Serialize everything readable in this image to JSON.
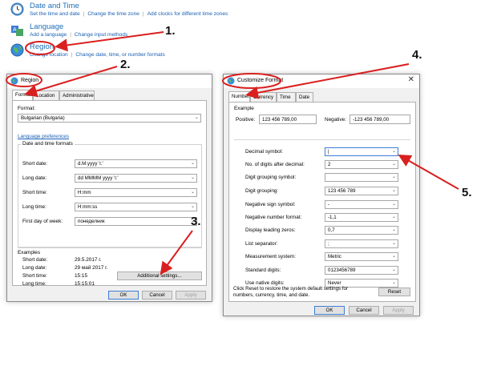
{
  "control_panel": {
    "date_time": {
      "title": "Date and Time",
      "links": [
        "Set the time and date",
        "Change the time zone",
        "Add clocks for different time zones"
      ]
    },
    "language": {
      "title": "Language",
      "links": [
        "Add a language",
        "Change input methods"
      ]
    },
    "region": {
      "title": "Region",
      "links": [
        "Change location",
        "Change date, time, or number formats"
      ]
    }
  },
  "region_dialog": {
    "title": "Region",
    "tabs": [
      "Formats",
      "Location",
      "Administrative"
    ],
    "format_label": "Format:",
    "format_value": "Bulgarian (Bulgaria)",
    "language_preferences": "Language preferences",
    "group_title": "Date and time formats",
    "fields": [
      {
        "label": "Short date:",
        "value": "d.M.yyyy 'г.'"
      },
      {
        "label": "Long date:",
        "value": "dd MMMM yyyy 'г.'"
      },
      {
        "label": "Short time:",
        "value": "H:mm"
      },
      {
        "label": "Long time:",
        "value": "H:mm:ss"
      },
      {
        "label": "First day of week:",
        "value": "понеделник"
      }
    ],
    "examples_title": "Examples",
    "examples": [
      {
        "label": "Short date:",
        "value": "29.5.2017 г."
      },
      {
        "label": "Long date:",
        "value": "29 май 2017 г."
      },
      {
        "label": "Short time:",
        "value": "15:15"
      },
      {
        "label": "Long time:",
        "value": "15:15:01"
      }
    ],
    "additional_settings": "Additional settings...",
    "buttons": {
      "ok": "OK",
      "cancel": "Cancel",
      "apply": "Apply"
    }
  },
  "customize_dialog": {
    "title": "Customize Format",
    "tabs": [
      "Numbers",
      "Currency",
      "Time",
      "Date"
    ],
    "example_title": "Example",
    "positive_label": "Positive:",
    "positive_value": "123 456 789,00",
    "negative_label": "Negative:",
    "negative_value": "-123 456 789,00",
    "fields": [
      {
        "label": "Decimal symbol:",
        "value": "|"
      },
      {
        "label": "No. of digits after decimal:",
        "value": "2"
      },
      {
        "label": "Digit grouping symbol:",
        "value": ""
      },
      {
        "label": "Digit grouping:",
        "value": "123 456 789"
      },
      {
        "label": "Negative sign symbol:",
        "value": "-"
      },
      {
        "label": "Negative number format:",
        "value": "-1,1"
      },
      {
        "label": "Display leading zeros:",
        "value": "0,7"
      },
      {
        "label": "List separator:",
        "value": ";"
      },
      {
        "label": "Measurement system:",
        "value": "Metric"
      },
      {
        "label": "Standard digits:",
        "value": "0123456789"
      },
      {
        "label": "Use native digits:",
        "value": "Never"
      }
    ],
    "reset_note": "Click Reset to restore the system default settings for numbers, currency, time, and date.",
    "reset": "Reset",
    "buttons": {
      "ok": "OK",
      "cancel": "Cancel",
      "apply": "Apply"
    }
  },
  "annotations": [
    "1.",
    "2.",
    "3.",
    "4.",
    "5."
  ],
  "colors": {
    "annotation_red": "#d9201f",
    "link_blue": "#1a5fb4",
    "title_blue": "#1e6fb8"
  }
}
